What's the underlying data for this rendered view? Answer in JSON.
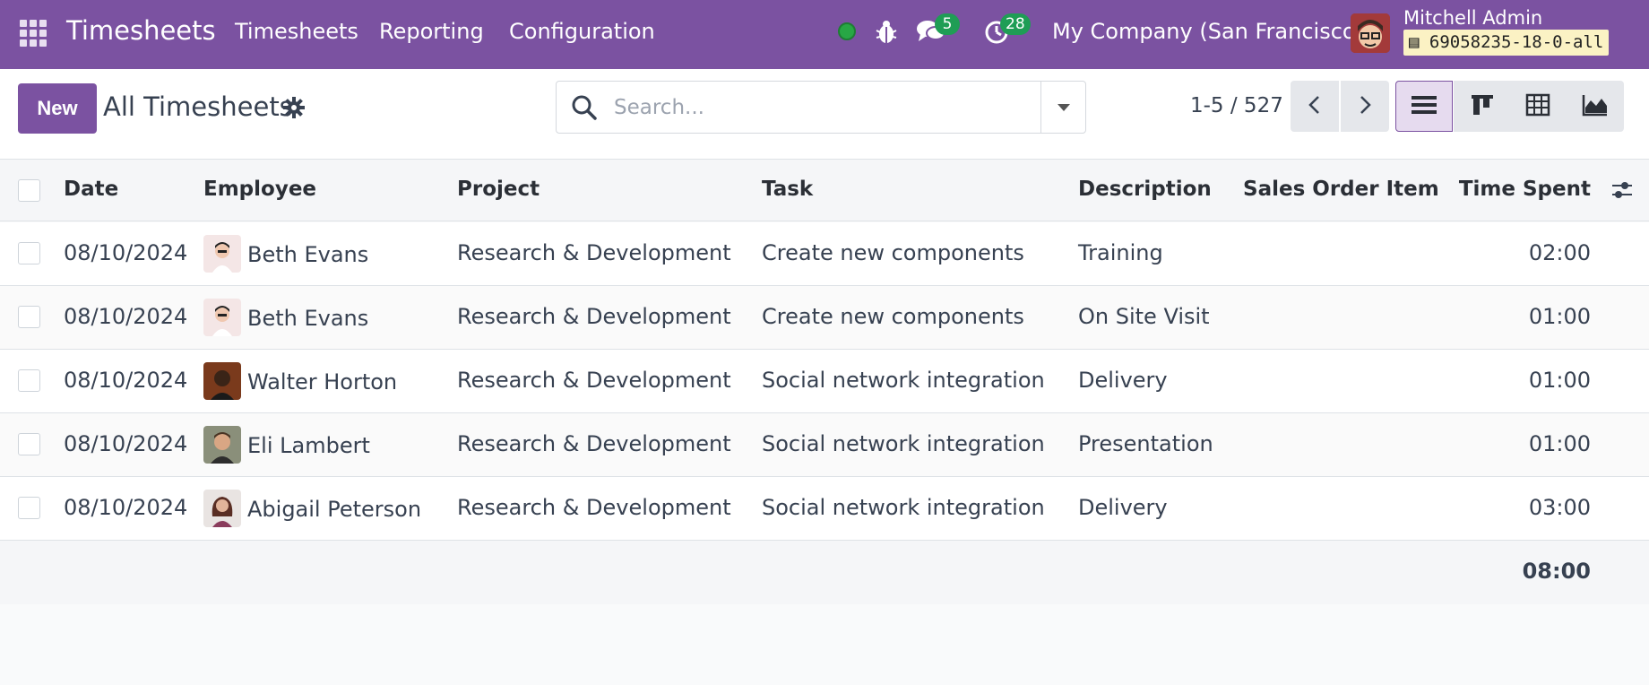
{
  "app": {
    "brand": "Timesheets",
    "menu": [
      "Timesheets",
      "Reporting",
      "Configuration"
    ],
    "messages_count": "5",
    "activities_count": "28",
    "company": "My Company (San Francisco)",
    "user_name": "Mitchell Admin",
    "db_tag": "69058235-18-0-all",
    "colors": {
      "brand": "#7b52a1",
      "badge": "#1f9d55",
      "online": "#28a745"
    }
  },
  "control": {
    "new_label": "New",
    "breadcrumb": "All Timesheets",
    "search_placeholder": "Search...",
    "pager": "1-5 / 527",
    "views": [
      "list-view-icon",
      "kanban-view-icon",
      "pivot-view-icon",
      "graph-view-icon"
    ],
    "active_view": "list"
  },
  "table": {
    "columns": [
      "Date",
      "Employee",
      "Project",
      "Task",
      "Description",
      "Sales Order Item",
      "Time Spent"
    ],
    "rows": [
      {
        "date": "08/10/2024",
        "employee": "Beth Evans",
        "project": "Research & Development",
        "task": "Create new components",
        "description": "Training",
        "sales_order_item": "",
        "time_spent": "02:00"
      },
      {
        "date": "08/10/2024",
        "employee": "Beth Evans",
        "project": "Research & Development",
        "task": "Create new components",
        "description": "On Site Visit",
        "sales_order_item": "",
        "time_spent": "01:00"
      },
      {
        "date": "08/10/2024",
        "employee": "Walter Horton",
        "project": "Research & Development",
        "task": "Social network integration",
        "description": "Delivery",
        "sales_order_item": "",
        "time_spent": "01:00"
      },
      {
        "date": "08/10/2024",
        "employee": "Eli Lambert",
        "project": "Research & Development",
        "task": "Social network integration",
        "description": "Presentation",
        "sales_order_item": "",
        "time_spent": "01:00"
      },
      {
        "date": "08/10/2024",
        "employee": "Abigail Peterson",
        "project": "Research & Development",
        "task": "Social network integration",
        "description": "Delivery",
        "sales_order_item": "",
        "time_spent": "03:00"
      }
    ],
    "total_time": "08:00"
  }
}
